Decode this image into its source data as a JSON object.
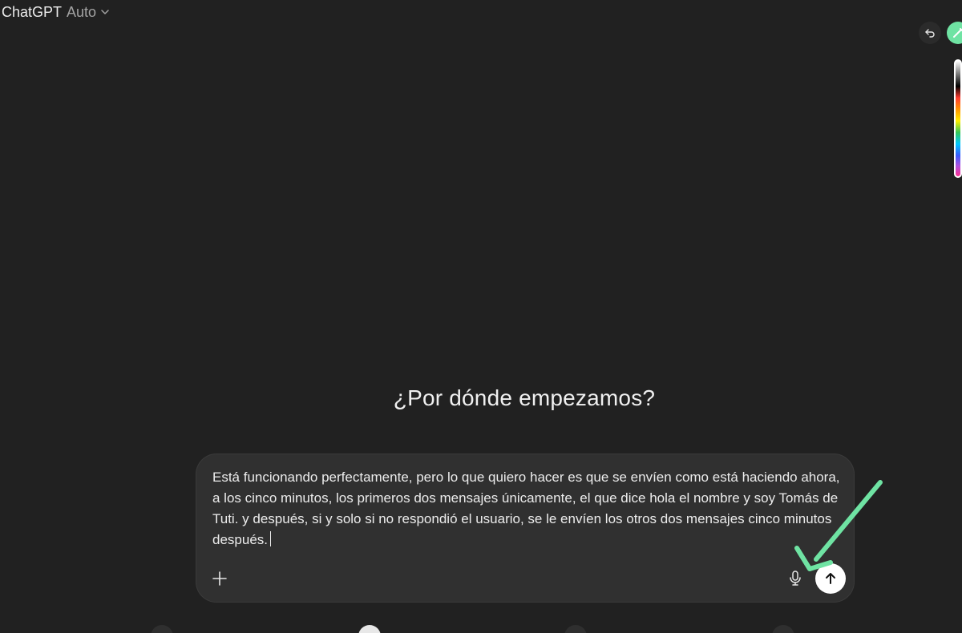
{
  "header": {
    "brand": "ChatGPT",
    "model": "Auto",
    "chevron_icon": "chevron-down-icon"
  },
  "toolbar": {
    "undo_icon": "undo-icon",
    "pen_icon": "pen-icon",
    "pen_color": "#6fe3a3"
  },
  "main": {
    "headline": "¿Por dónde empezamos?"
  },
  "composer": {
    "text": "Está funcionando perfectamente, pero lo que quiero hacer es que se envíen como está haciendo ahora, a los cinco minutos, los primeros dos mensajes únicamente, el que dice hola el nombre y soy Tomás de Tuti. y después, si y solo si no respondió el usuario, se le envíen los otros dos mensajes cinco minutos después.",
    "plus_icon": "plus-icon",
    "mic_icon": "microphone-icon",
    "send_icon": "arrow-up-icon"
  },
  "annotation": {
    "arrow_color": "#6fe3a3"
  }
}
